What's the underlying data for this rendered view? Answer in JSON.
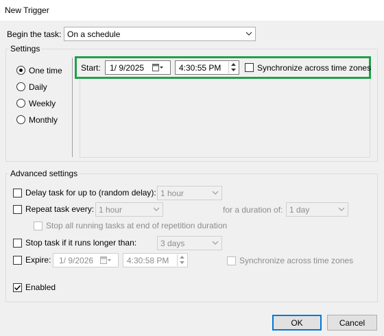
{
  "window": {
    "title": "New Trigger"
  },
  "begin": {
    "label": "Begin the task:",
    "value": "On a schedule"
  },
  "settings": {
    "legend": "Settings",
    "radios": [
      {
        "label": "One time",
        "checked": true
      },
      {
        "label": "Daily",
        "checked": false
      },
      {
        "label": "Weekly",
        "checked": false
      },
      {
        "label": "Monthly",
        "checked": false
      }
    ],
    "start_label": "Start:",
    "start_date": "1/ 9/2025",
    "start_time": "4:30:55 PM",
    "sync_label": "Synchronize across time zones",
    "highlight_color": "#1fa04a"
  },
  "advanced": {
    "legend": "Advanced settings",
    "delay": {
      "label": "Delay task for up to (random delay):",
      "value": "1 hour"
    },
    "repeat": {
      "label": "Repeat task every:",
      "value": "1 hour",
      "duration_label": "for a duration of:",
      "duration_value": "1 day"
    },
    "stop_running_label": "Stop all running tasks at end of repetition duration",
    "stop_if": {
      "label": "Stop task if it runs longer than:",
      "value": "3 days"
    },
    "expire": {
      "label": "Expire:",
      "date": "1/ 9/2026",
      "time": "4:30:58 PM",
      "sync_label": "Synchronize across time zones"
    },
    "enabled": {
      "label": "Enabled",
      "checked": true
    }
  },
  "buttons": {
    "ok": "OK",
    "cancel": "Cancel"
  },
  "colors": {
    "accent": "#0078d7",
    "dialog_bg": "#f0f0f0"
  }
}
